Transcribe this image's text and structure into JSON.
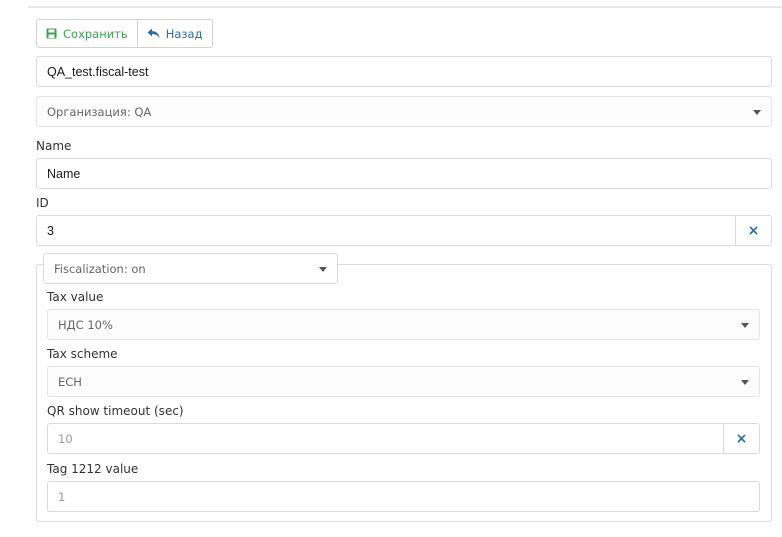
{
  "toolbar": {
    "save_label": "Сохранить",
    "back_label": "Назад"
  },
  "form": {
    "code_value": "QA_test.fiscal-test",
    "organization_select": "Организация: QA",
    "name_label": "Name",
    "name_value": "Name",
    "id_label": "ID",
    "id_value": "3",
    "clear_symbol": "×"
  },
  "fiscal": {
    "toggle_select": "Fiscalization: on",
    "tax_value_label": "Tax value",
    "tax_value_select": "НДС 10%",
    "tax_scheme_label": "Tax scheme",
    "tax_scheme_select": "ЕСН",
    "qr_timeout_label": "QR show timeout (sec)",
    "qr_timeout_value": "10",
    "tag1212_label": "Tag 1212 value",
    "tag1212_value": "1"
  },
  "colors": {
    "save_green": "#3aa352",
    "link_blue": "#2a6db0"
  }
}
